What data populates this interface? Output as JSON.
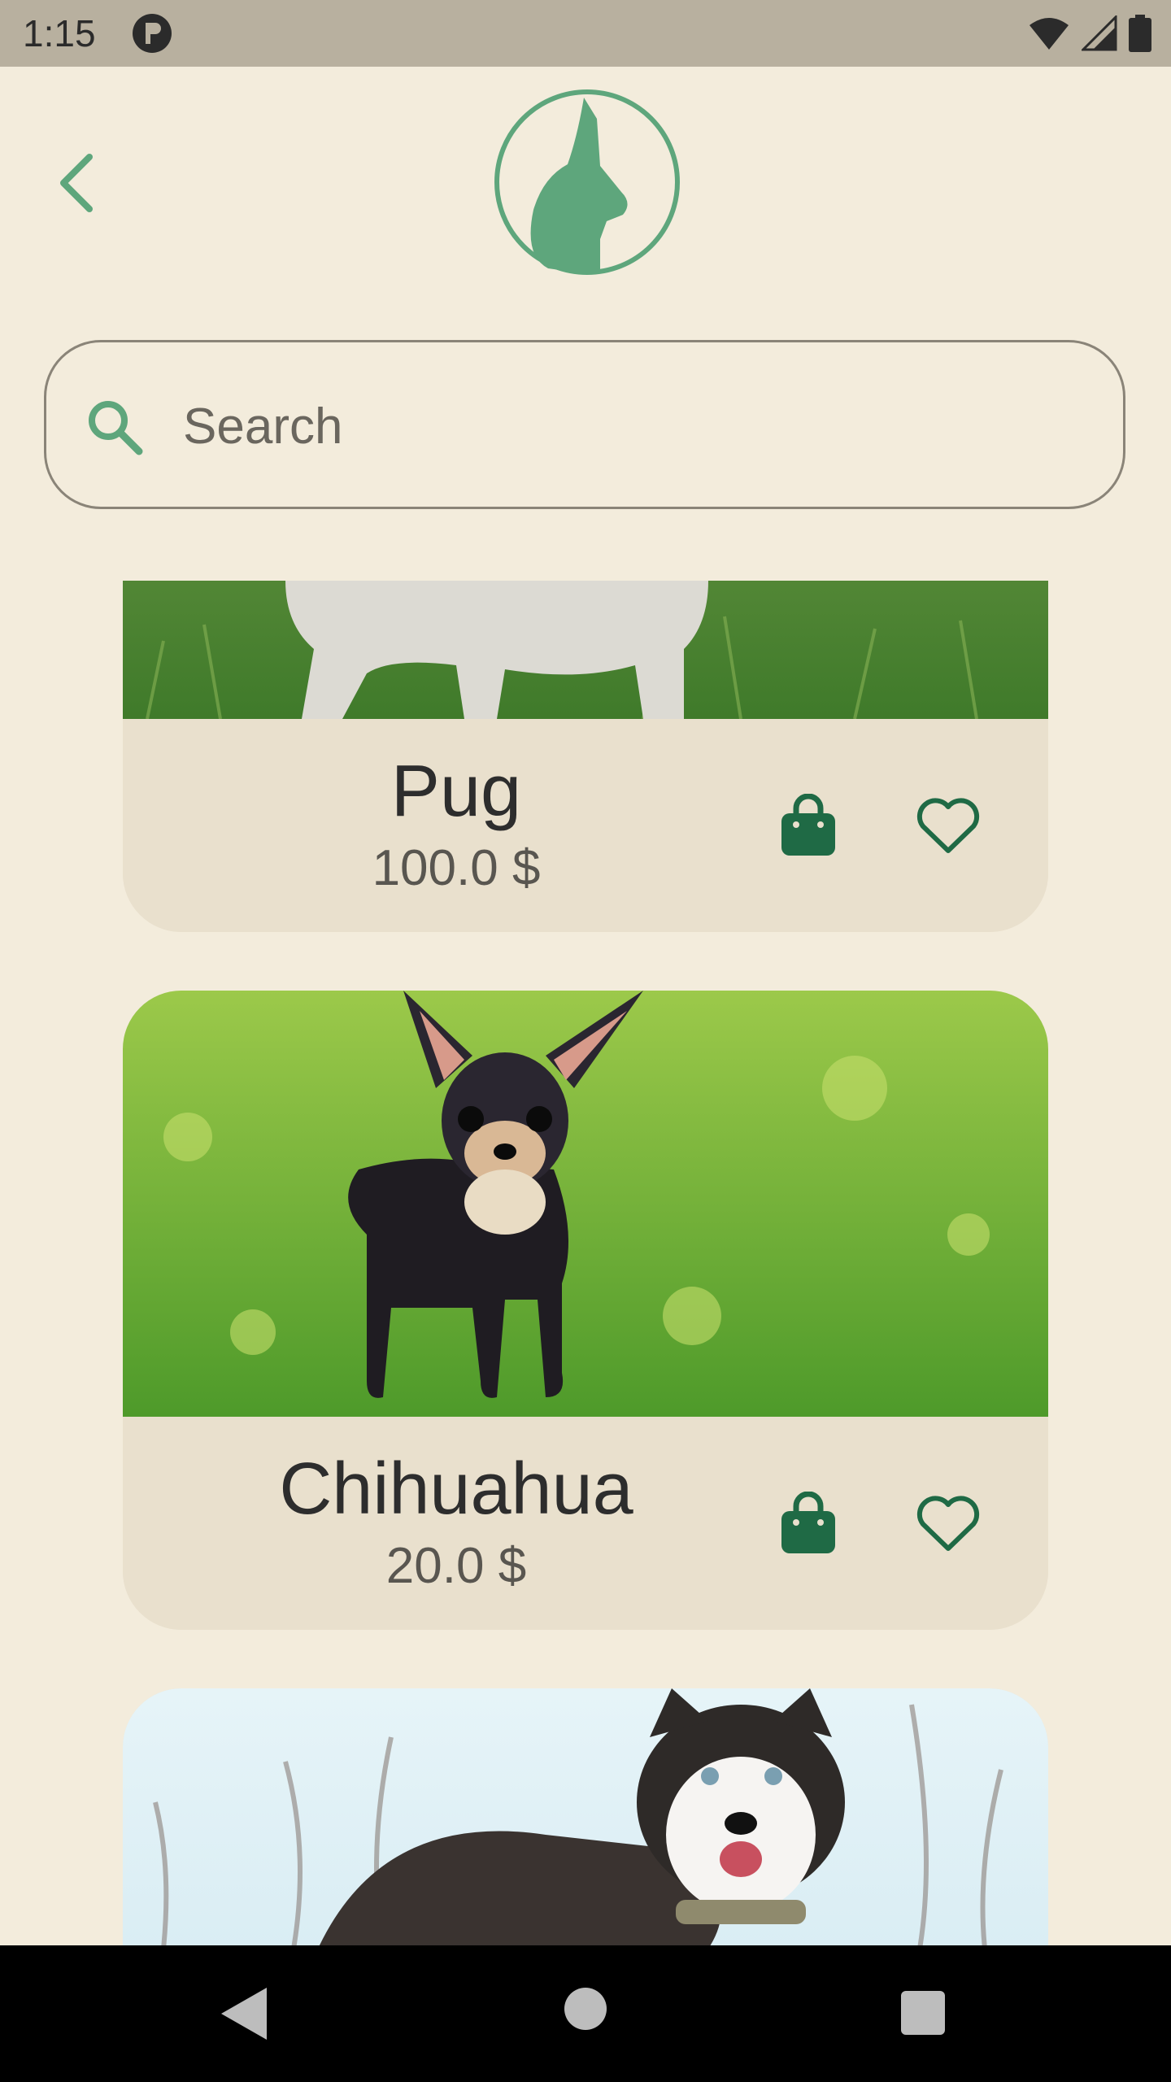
{
  "status_bar": {
    "time": "1:15"
  },
  "search": {
    "placeholder": "Search",
    "value": ""
  },
  "products": [
    {
      "name": "Pug",
      "price": "100.0 $"
    },
    {
      "name": "Chihuahua",
      "price": "20.0 $"
    },
    {
      "name": "",
      "price": ""
    }
  ],
  "colors": {
    "background": "#f3ecdc",
    "accent_green": "#5ea67c",
    "dark_green": "#1f6a45",
    "card_footer": "#e9e0cd",
    "status_bar": "#b8b09f"
  },
  "icons": {
    "back": "chevron-left-icon",
    "logo": "chihuahua-logo",
    "search": "search-icon",
    "cart": "shopping-bag-icon",
    "favorite": "heart-outline-icon"
  }
}
